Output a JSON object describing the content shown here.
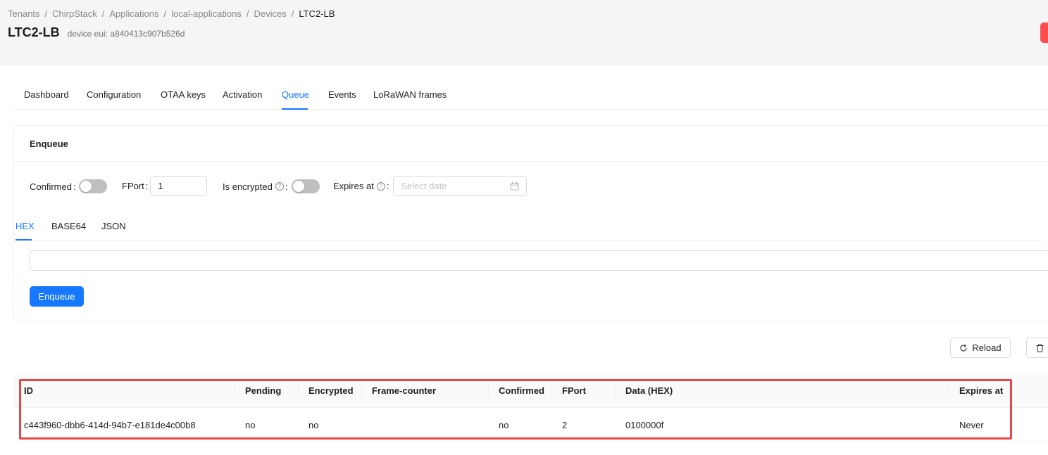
{
  "breadcrumb": {
    "items": [
      "Tenants",
      "ChirpStack",
      "Applications",
      "local-applications",
      "Devices",
      "LTC2-LB"
    ],
    "separator": "/"
  },
  "header": {
    "title": "LTC2-LB",
    "subtitle": "device eui: a840413c907b526d",
    "action_color": "#ff4d4f"
  },
  "tabs": {
    "items": [
      "Dashboard",
      "Configuration",
      "OTAA keys",
      "Activation",
      "Queue",
      "Events",
      "LoRaWAN frames"
    ],
    "active": "Queue"
  },
  "enqueue_card": {
    "title": "Enqueue",
    "confirmed_label": "Confirmed",
    "fport_label": "FPort",
    "fport_value": "1",
    "encrypted_label": "Is encrypted",
    "expires_label": "Expires at",
    "date_placeholder": "Select date",
    "colon": ":",
    "help_glyph": "?",
    "payload_tabs": [
      "HEX",
      "BASE64",
      "JSON"
    ],
    "payload_active": "HEX",
    "payload_value": "",
    "button_label": "Enqueue"
  },
  "actions": {
    "reload_label": "Reload"
  },
  "queue_table": {
    "columns": [
      "ID",
      "Pending",
      "Encrypted",
      "Frame-counter",
      "Confirmed",
      "FPort",
      "Data (HEX)",
      "Expires at"
    ],
    "rows": [
      {
        "id": "c443f960-dbb6-414d-94b7-e181de4c00b8",
        "pending": "no",
        "encrypted": "no",
        "frame_counter": "",
        "confirmed": "no",
        "fport": "2",
        "data_hex": "0100000f",
        "expires_at": "Never"
      }
    ]
  },
  "colors": {
    "accent": "#1677ff",
    "highlight": "#e8474a"
  }
}
